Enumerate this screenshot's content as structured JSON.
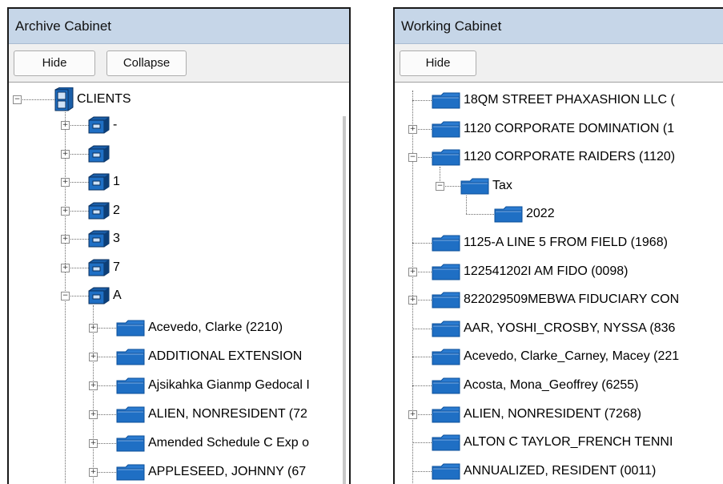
{
  "archive": {
    "title": "Archive Cabinet",
    "buttons": {
      "hide": "Hide",
      "collapse": "Collapse"
    },
    "root": "CLIENTS",
    "groups": [
      "-",
      "",
      "1",
      "2",
      "3",
      "7",
      "A"
    ],
    "clients": [
      "Acevedo, Clarke (2210)",
      "ADDITIONAL EXTENSION",
      "Ajsikahka Gianmp Gedocal I",
      "ALIEN, NONRESIDENT (72",
      "Amended Schedule C Exp o",
      "APPLESEED, JOHNNY (67"
    ]
  },
  "working": {
    "title": "Working Cabinet",
    "buttons": {
      "hide": "Hide"
    },
    "items": [
      "18QM STREET PHAXASHION LLC (",
      "1120 CORPORATE DOMINATION (1",
      "1120 CORPORATE RAIDERS (1120)",
      "Tax",
      "2022",
      "1125-A LINE 5 FROM FIELD (1968)",
      "122541202I AM FIDO (0098)",
      "822029509MEBWA FIDUCIARY CON",
      "AAR, YOSHI_CROSBY, NYSSA (836",
      "Acevedo, Clarke_Carney, Macey (221",
      "Acosta, Mona_Geoffrey (6255)",
      "ALIEN, NONRESIDENT (7268)",
      "ALTON C TAYLOR_FRENCH TENNI",
      "ANNUALIZED, RESIDENT (0011)"
    ]
  },
  "icons": {
    "drawer": "cabinet-drawer-icon",
    "cabinet": "file-cabinet-icon",
    "folder": "folder-icon"
  },
  "colors": {
    "title_bar": "#c6d6e8",
    "folder": "#1f6fc4",
    "drawer": "#1f6fc4"
  }
}
